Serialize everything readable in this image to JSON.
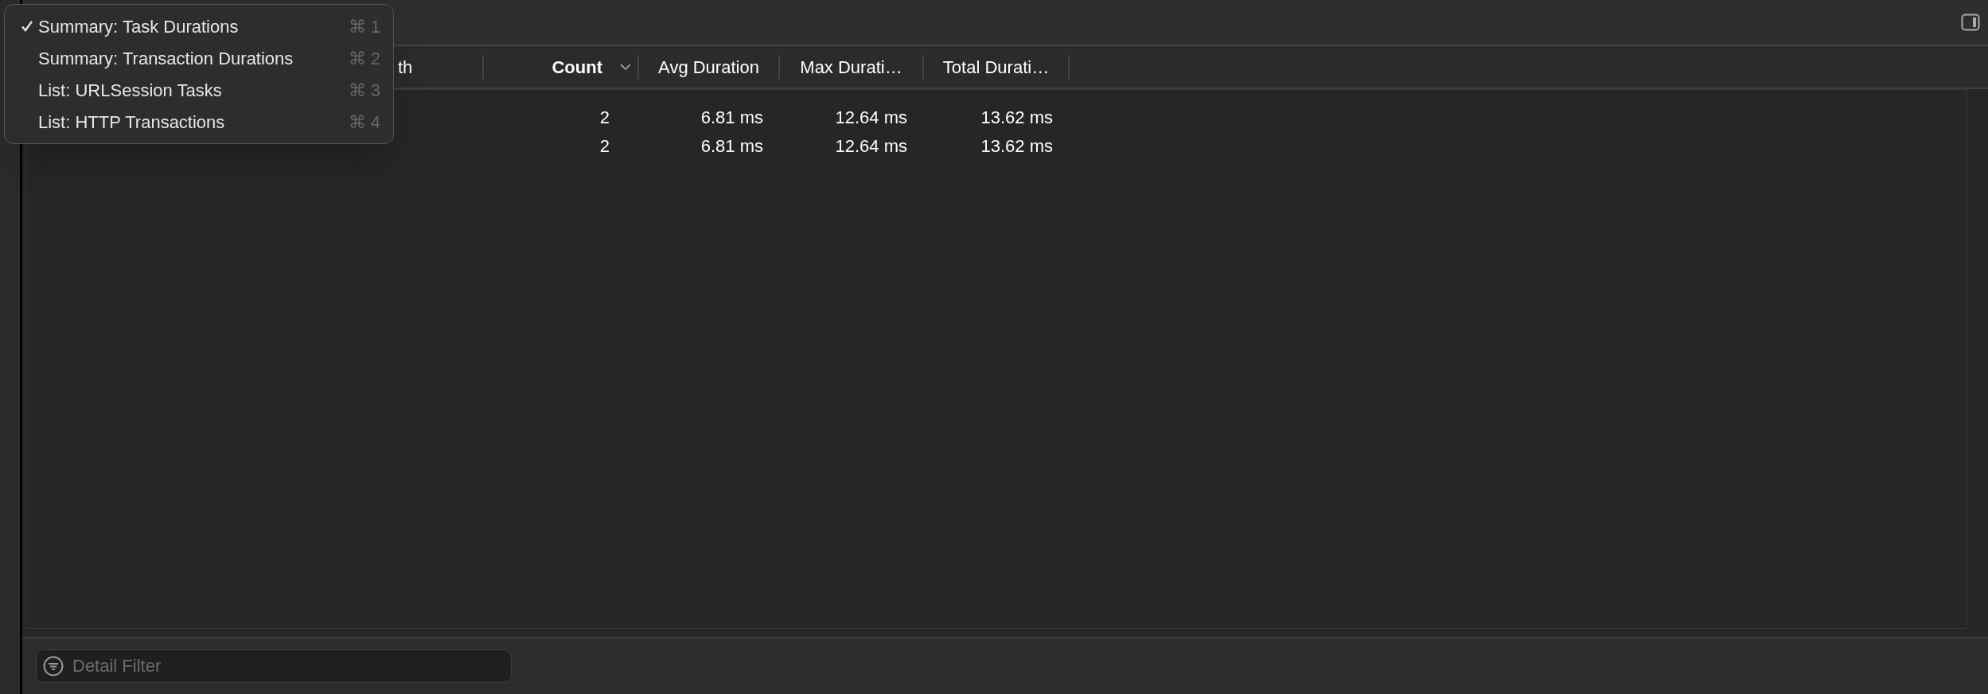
{
  "menu": {
    "items": [
      {
        "label": "Summary: Task Durations",
        "shortcut": "⌘ 1",
        "selected": true
      },
      {
        "label": "Summary: Transaction Durations",
        "shortcut": "⌘ 2",
        "selected": false
      },
      {
        "label": "List: URLSession Tasks",
        "shortcut": "⌘ 3",
        "selected": false
      },
      {
        "label": "List: HTTP Transactions",
        "shortcut": "⌘ 4",
        "selected": false
      }
    ]
  },
  "table": {
    "columns": [
      {
        "label": "th",
        "sorted": false
      },
      {
        "label": "Count",
        "sorted": true
      },
      {
        "label": "Avg Duration",
        "sorted": false
      },
      {
        "label": "Max Durati…",
        "sorted": false
      },
      {
        "label": "Total Durati…",
        "sorted": false
      }
    ],
    "rows": [
      {
        "cells": [
          "",
          "2",
          "6.81 ms",
          "12.64 ms",
          "13.62 ms"
        ]
      },
      {
        "cells": [
          "",
          "2",
          "6.81 ms",
          "12.64 ms",
          "13.62 ms"
        ]
      }
    ]
  },
  "filter": {
    "placeholder": "Detail Filter"
  }
}
